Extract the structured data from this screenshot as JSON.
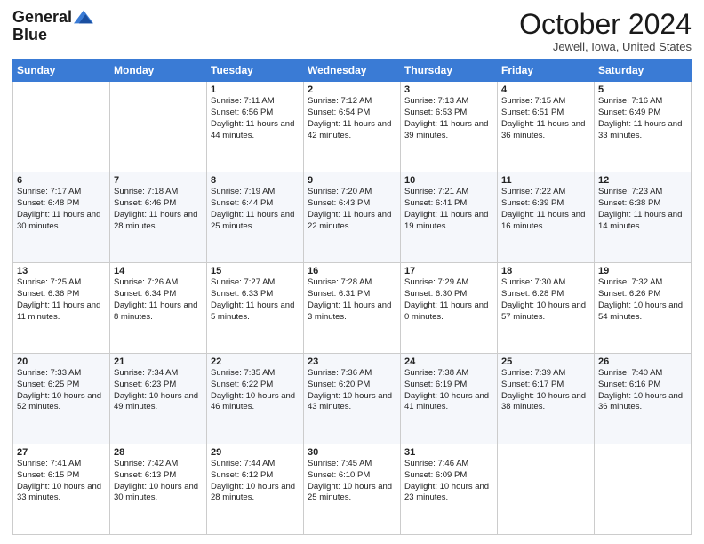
{
  "header": {
    "logo_general": "General",
    "logo_blue": "Blue",
    "month": "October 2024",
    "location": "Jewell, Iowa, United States"
  },
  "weekdays": [
    "Sunday",
    "Monday",
    "Tuesday",
    "Wednesday",
    "Thursday",
    "Friday",
    "Saturday"
  ],
  "weeks": [
    [
      {
        "day": "",
        "sunrise": "",
        "sunset": "",
        "daylight": "",
        "empty": true
      },
      {
        "day": "",
        "sunrise": "",
        "sunset": "",
        "daylight": "",
        "empty": true
      },
      {
        "day": "1",
        "sunrise": "Sunrise: 7:11 AM",
        "sunset": "Sunset: 6:56 PM",
        "daylight": "Daylight: 11 hours and 44 minutes.",
        "empty": false
      },
      {
        "day": "2",
        "sunrise": "Sunrise: 7:12 AM",
        "sunset": "Sunset: 6:54 PM",
        "daylight": "Daylight: 11 hours and 42 minutes.",
        "empty": false
      },
      {
        "day": "3",
        "sunrise": "Sunrise: 7:13 AM",
        "sunset": "Sunset: 6:53 PM",
        "daylight": "Daylight: 11 hours and 39 minutes.",
        "empty": false
      },
      {
        "day": "4",
        "sunrise": "Sunrise: 7:15 AM",
        "sunset": "Sunset: 6:51 PM",
        "daylight": "Daylight: 11 hours and 36 minutes.",
        "empty": false
      },
      {
        "day": "5",
        "sunrise": "Sunrise: 7:16 AM",
        "sunset": "Sunset: 6:49 PM",
        "daylight": "Daylight: 11 hours and 33 minutes.",
        "empty": false
      }
    ],
    [
      {
        "day": "6",
        "sunrise": "Sunrise: 7:17 AM",
        "sunset": "Sunset: 6:48 PM",
        "daylight": "Daylight: 11 hours and 30 minutes.",
        "empty": false
      },
      {
        "day": "7",
        "sunrise": "Sunrise: 7:18 AM",
        "sunset": "Sunset: 6:46 PM",
        "daylight": "Daylight: 11 hours and 28 minutes.",
        "empty": false
      },
      {
        "day": "8",
        "sunrise": "Sunrise: 7:19 AM",
        "sunset": "Sunset: 6:44 PM",
        "daylight": "Daylight: 11 hours and 25 minutes.",
        "empty": false
      },
      {
        "day": "9",
        "sunrise": "Sunrise: 7:20 AM",
        "sunset": "Sunset: 6:43 PM",
        "daylight": "Daylight: 11 hours and 22 minutes.",
        "empty": false
      },
      {
        "day": "10",
        "sunrise": "Sunrise: 7:21 AM",
        "sunset": "Sunset: 6:41 PM",
        "daylight": "Daylight: 11 hours and 19 minutes.",
        "empty": false
      },
      {
        "day": "11",
        "sunrise": "Sunrise: 7:22 AM",
        "sunset": "Sunset: 6:39 PM",
        "daylight": "Daylight: 11 hours and 16 minutes.",
        "empty": false
      },
      {
        "day": "12",
        "sunrise": "Sunrise: 7:23 AM",
        "sunset": "Sunset: 6:38 PM",
        "daylight": "Daylight: 11 hours and 14 minutes.",
        "empty": false
      }
    ],
    [
      {
        "day": "13",
        "sunrise": "Sunrise: 7:25 AM",
        "sunset": "Sunset: 6:36 PM",
        "daylight": "Daylight: 11 hours and 11 minutes.",
        "empty": false
      },
      {
        "day": "14",
        "sunrise": "Sunrise: 7:26 AM",
        "sunset": "Sunset: 6:34 PM",
        "daylight": "Daylight: 11 hours and 8 minutes.",
        "empty": false
      },
      {
        "day": "15",
        "sunrise": "Sunrise: 7:27 AM",
        "sunset": "Sunset: 6:33 PM",
        "daylight": "Daylight: 11 hours and 5 minutes.",
        "empty": false
      },
      {
        "day": "16",
        "sunrise": "Sunrise: 7:28 AM",
        "sunset": "Sunset: 6:31 PM",
        "daylight": "Daylight: 11 hours and 3 minutes.",
        "empty": false
      },
      {
        "day": "17",
        "sunrise": "Sunrise: 7:29 AM",
        "sunset": "Sunset: 6:30 PM",
        "daylight": "Daylight: 11 hours and 0 minutes.",
        "empty": false
      },
      {
        "day": "18",
        "sunrise": "Sunrise: 7:30 AM",
        "sunset": "Sunset: 6:28 PM",
        "daylight": "Daylight: 10 hours and 57 minutes.",
        "empty": false
      },
      {
        "day": "19",
        "sunrise": "Sunrise: 7:32 AM",
        "sunset": "Sunset: 6:26 PM",
        "daylight": "Daylight: 10 hours and 54 minutes.",
        "empty": false
      }
    ],
    [
      {
        "day": "20",
        "sunrise": "Sunrise: 7:33 AM",
        "sunset": "Sunset: 6:25 PM",
        "daylight": "Daylight: 10 hours and 52 minutes.",
        "empty": false
      },
      {
        "day": "21",
        "sunrise": "Sunrise: 7:34 AM",
        "sunset": "Sunset: 6:23 PM",
        "daylight": "Daylight: 10 hours and 49 minutes.",
        "empty": false
      },
      {
        "day": "22",
        "sunrise": "Sunrise: 7:35 AM",
        "sunset": "Sunset: 6:22 PM",
        "daylight": "Daylight: 10 hours and 46 minutes.",
        "empty": false
      },
      {
        "day": "23",
        "sunrise": "Sunrise: 7:36 AM",
        "sunset": "Sunset: 6:20 PM",
        "daylight": "Daylight: 10 hours and 43 minutes.",
        "empty": false
      },
      {
        "day": "24",
        "sunrise": "Sunrise: 7:38 AM",
        "sunset": "Sunset: 6:19 PM",
        "daylight": "Daylight: 10 hours and 41 minutes.",
        "empty": false
      },
      {
        "day": "25",
        "sunrise": "Sunrise: 7:39 AM",
        "sunset": "Sunset: 6:17 PM",
        "daylight": "Daylight: 10 hours and 38 minutes.",
        "empty": false
      },
      {
        "day": "26",
        "sunrise": "Sunrise: 7:40 AM",
        "sunset": "Sunset: 6:16 PM",
        "daylight": "Daylight: 10 hours and 36 minutes.",
        "empty": false
      }
    ],
    [
      {
        "day": "27",
        "sunrise": "Sunrise: 7:41 AM",
        "sunset": "Sunset: 6:15 PM",
        "daylight": "Daylight: 10 hours and 33 minutes.",
        "empty": false
      },
      {
        "day": "28",
        "sunrise": "Sunrise: 7:42 AM",
        "sunset": "Sunset: 6:13 PM",
        "daylight": "Daylight: 10 hours and 30 minutes.",
        "empty": false
      },
      {
        "day": "29",
        "sunrise": "Sunrise: 7:44 AM",
        "sunset": "Sunset: 6:12 PM",
        "daylight": "Daylight: 10 hours and 28 minutes.",
        "empty": false
      },
      {
        "day": "30",
        "sunrise": "Sunrise: 7:45 AM",
        "sunset": "Sunset: 6:10 PM",
        "daylight": "Daylight: 10 hours and 25 minutes.",
        "empty": false
      },
      {
        "day": "31",
        "sunrise": "Sunrise: 7:46 AM",
        "sunset": "Sunset: 6:09 PM",
        "daylight": "Daylight: 10 hours and 23 minutes.",
        "empty": false
      },
      {
        "day": "",
        "sunrise": "",
        "sunset": "",
        "daylight": "",
        "empty": true
      },
      {
        "day": "",
        "sunrise": "",
        "sunset": "",
        "daylight": "",
        "empty": true
      }
    ]
  ]
}
